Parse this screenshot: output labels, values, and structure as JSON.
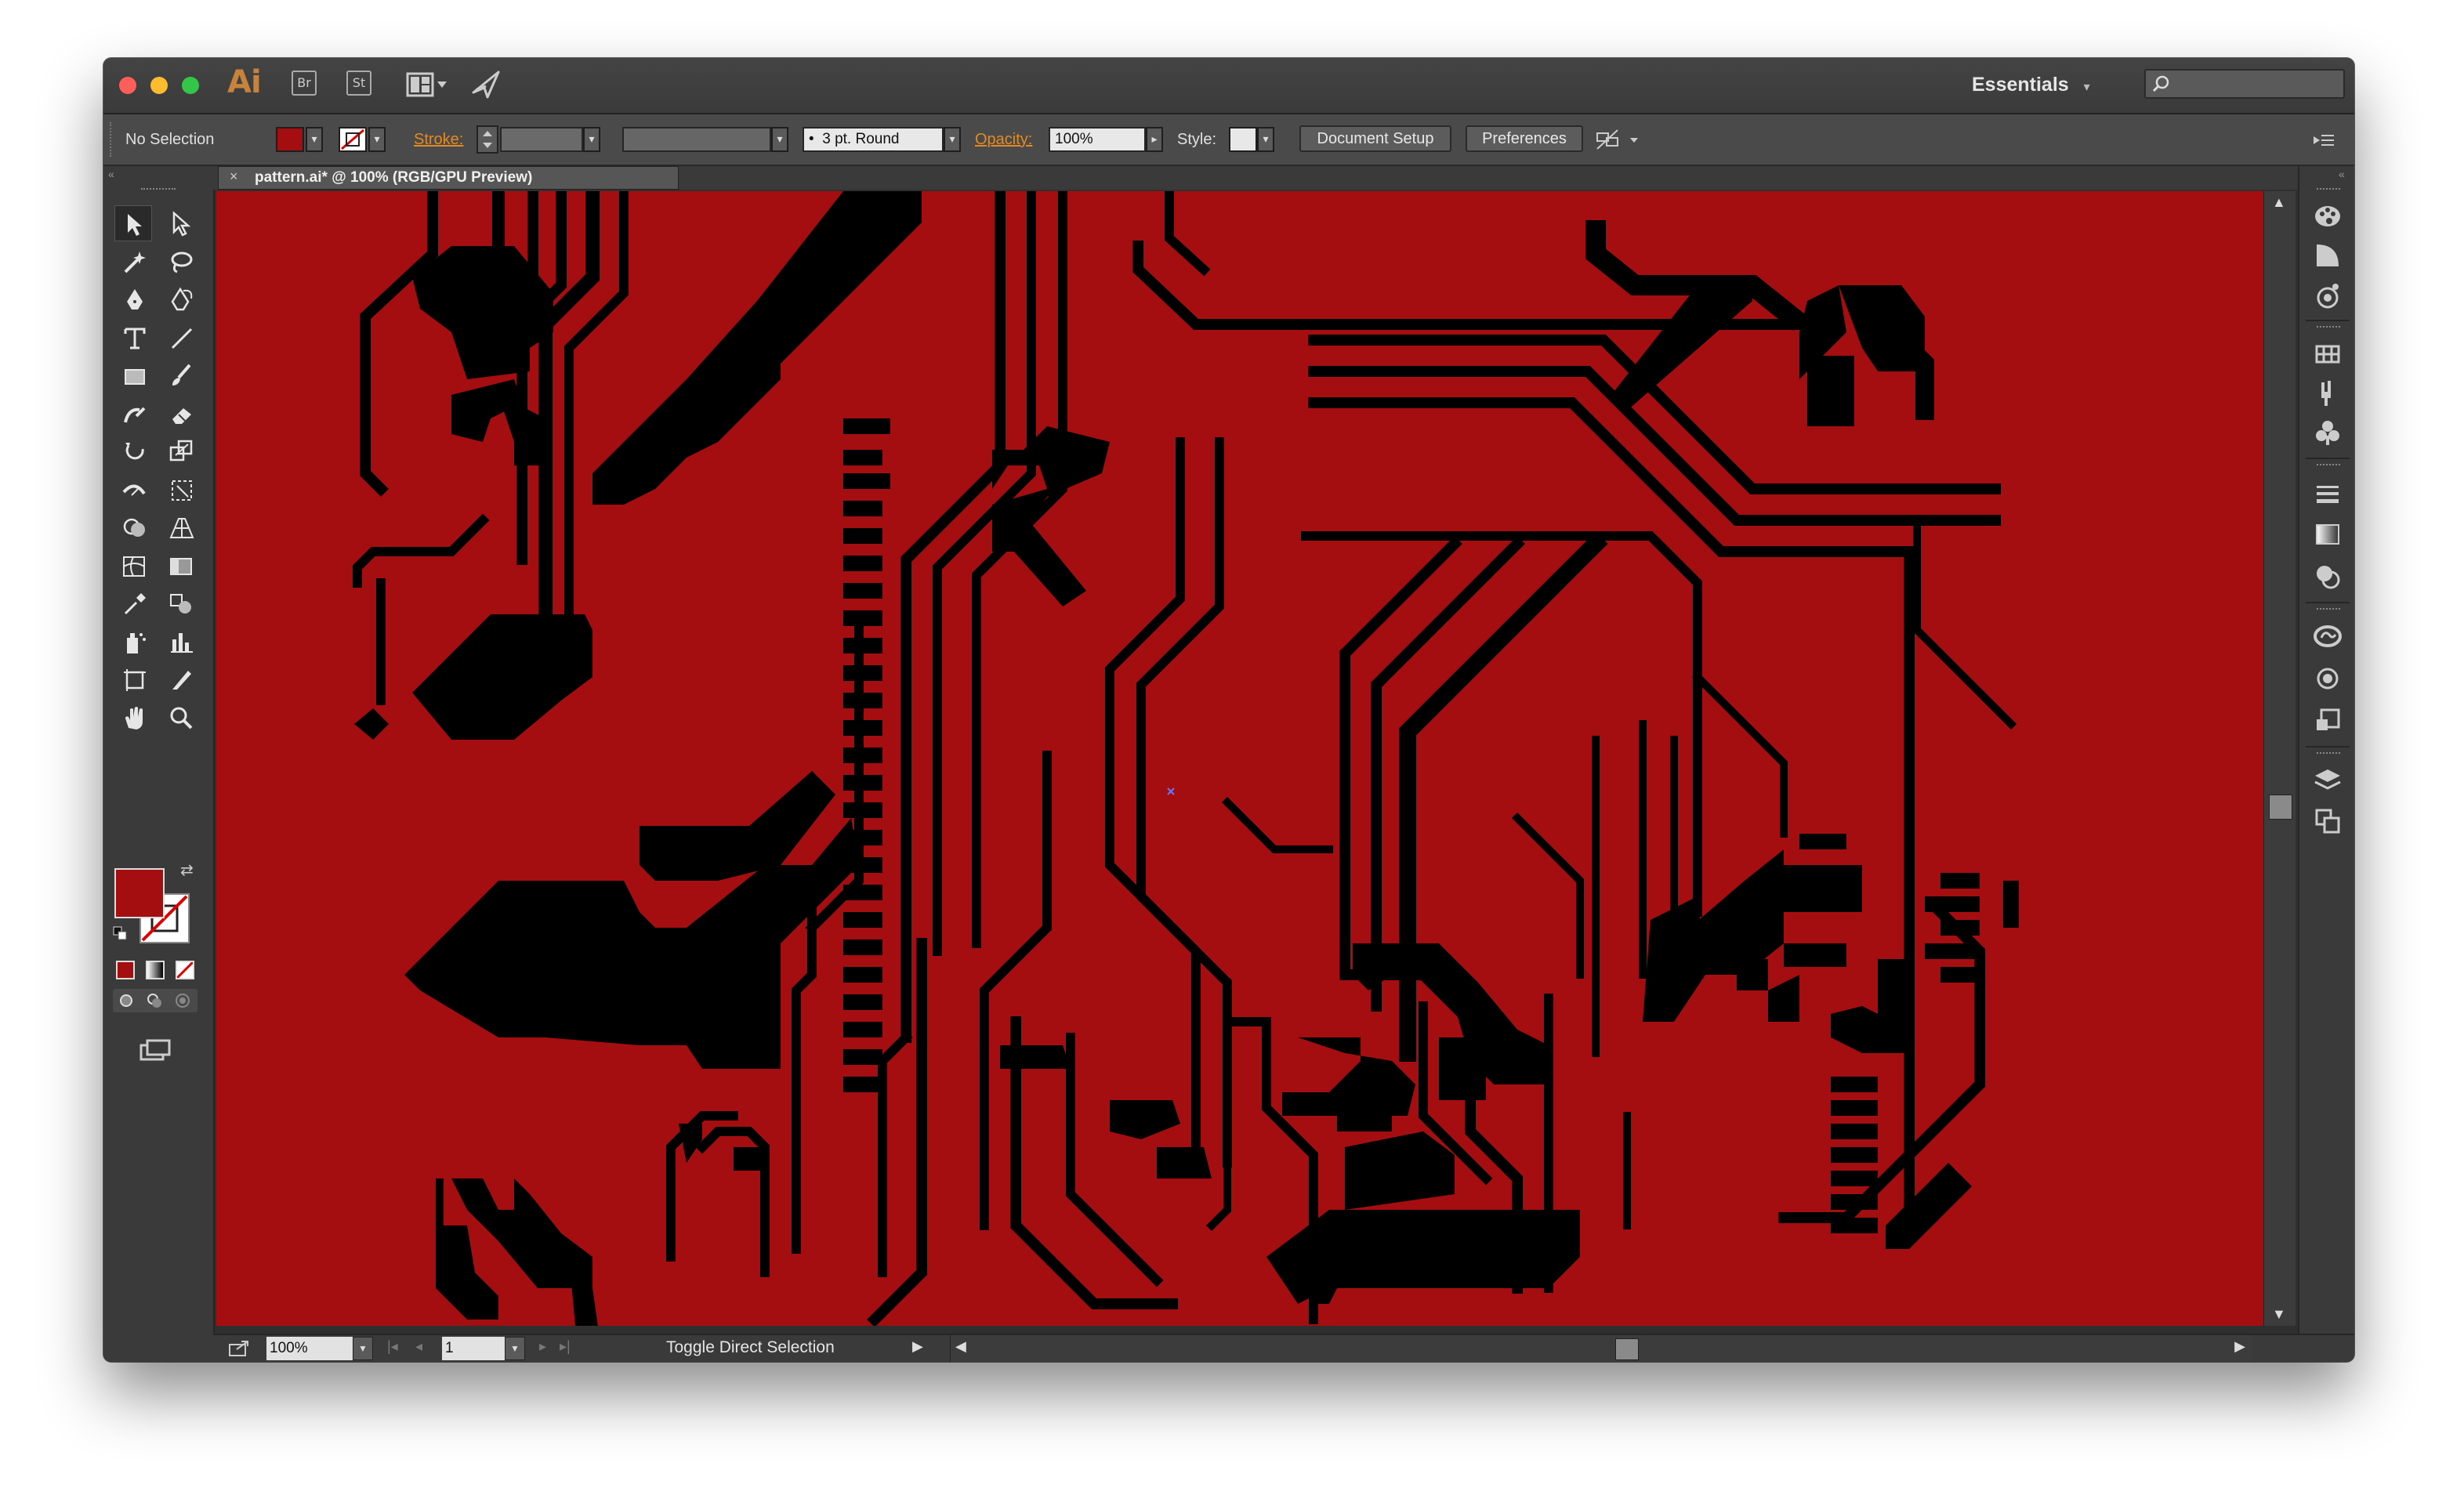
{
  "titlebar": {
    "app_logo": "Ai",
    "bridge_label": "Br",
    "stock_label": "St",
    "workspace_label": "Essentials",
    "workspace_caret": "▾",
    "search_placeholder": ""
  },
  "control_bar": {
    "selection_status": "No Selection",
    "fill_color": "#a50e10",
    "stroke_label": "Stroke:",
    "stroke_weight": "",
    "brush_definition": "3 pt. Round",
    "opacity_label": "Opacity:",
    "opacity_value": "100%",
    "style_label": "Style:",
    "document_setup_label": "Document Setup",
    "preferences_label": "Preferences"
  },
  "document_tab": {
    "close_glyph": "×",
    "title": "pattern.ai* @ 100% (RGB/GPU Preview)"
  },
  "status_bar": {
    "zoom_value": "100%",
    "artboard_number": "1",
    "status_text": "Toggle Direct Selection"
  },
  "tools": [
    "selection-tool",
    "direct-selection-tool",
    "magic-wand-tool",
    "lasso-tool",
    "pen-tool",
    "curvature-tool",
    "type-tool",
    "line-segment-tool",
    "rectangle-tool",
    "paintbrush-tool",
    "shaper-tool",
    "eraser-tool",
    "rotate-tool",
    "scale-tool",
    "width-tool",
    "free-transform-tool",
    "shape-builder-tool",
    "perspective-grid-tool",
    "mesh-tool",
    "gradient-tool",
    "eyedropper-tool",
    "blend-tool",
    "symbol-sprayer-tool",
    "column-graph-tool",
    "artboard-tool",
    "slice-tool",
    "hand-tool",
    "zoom-tool"
  ],
  "colors": {
    "canvas_background": "#a50e10",
    "artwork": "#000000",
    "fill_swatch": "#a50e10",
    "accent_label": "#e58a1f"
  }
}
